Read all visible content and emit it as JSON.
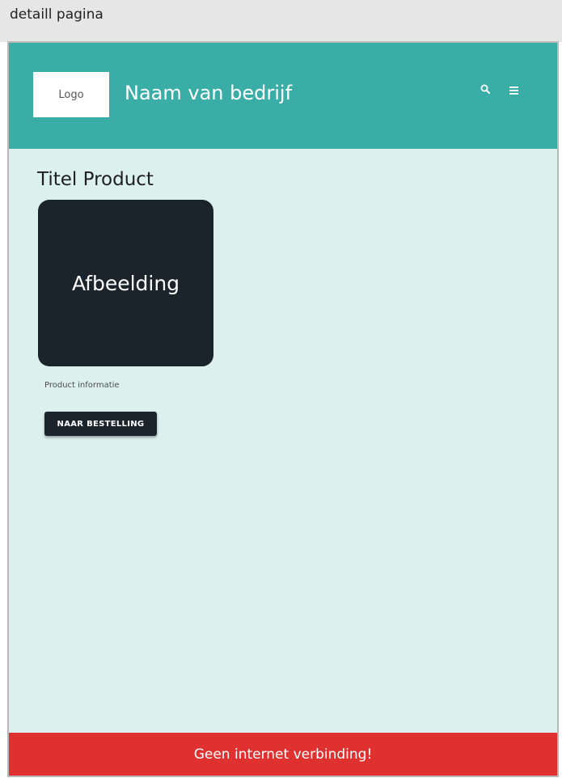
{
  "page_label": "detaill pagina",
  "header": {
    "logo_text": "Logo",
    "company_name": "Naam van bedrijf",
    "background": "#3aada6",
    "icons": [
      "search-icon",
      "menu-icon"
    ]
  },
  "main": {
    "title": "Titel Product",
    "image_placeholder": "Afbeelding",
    "product_info": "Product informatie",
    "order_button_label": "NAAR BESTELLING"
  },
  "status": {
    "message": "Geen internet verbinding!",
    "color": "#e03131"
  },
  "colors": {
    "content_background": "#dcf1ee",
    "dark": "#1b242b"
  }
}
